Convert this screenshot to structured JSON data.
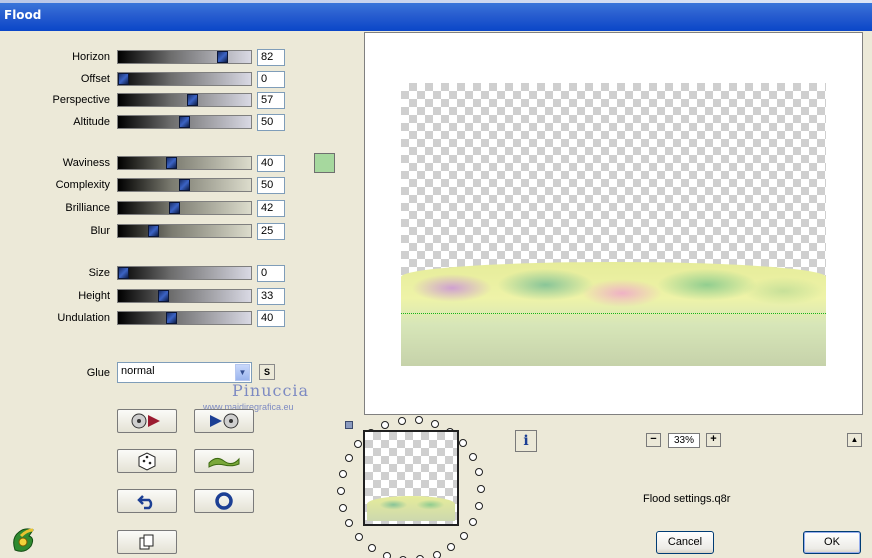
{
  "window": {
    "title": "Flood"
  },
  "parameters": [
    {
      "label": "Horizon",
      "value": "82",
      "fraction": 0.82
    },
    {
      "label": "Offset",
      "value": "0",
      "fraction": 0.0
    },
    {
      "label": "Perspective",
      "value": "57",
      "fraction": 0.57
    },
    {
      "label": "Altitude",
      "value": "50",
      "fraction": 0.5
    },
    {
      "label": "Waviness",
      "value": "40",
      "fraction": 0.4
    },
    {
      "label": "Complexity",
      "value": "50",
      "fraction": 0.5
    },
    {
      "label": "Brilliance",
      "value": "42",
      "fraction": 0.42
    },
    {
      "label": "Blur",
      "value": "25",
      "fraction": 0.25
    },
    {
      "label": "Size",
      "value": "0",
      "fraction": 0.0
    },
    {
      "label": "Height",
      "value": "33",
      "fraction": 0.33
    },
    {
      "label": "Undulation",
      "value": "40",
      "fraction": 0.4
    }
  ],
  "flood_color": "#a6d89e",
  "glue": {
    "label": "Glue",
    "value": "normal",
    "lock_label": "S"
  },
  "watermark": {
    "name": "Pinuccia",
    "site": "www.maidiregrafica.eu"
  },
  "tool_buttons": [
    {
      "name": "play-reverse-button",
      "icon": "reel-play-icon"
    },
    {
      "name": "play-forward-button",
      "icon": "play-reel-icon"
    },
    {
      "name": "random-button",
      "icon": "dice-icon"
    },
    {
      "name": "wave-button",
      "icon": "wave-icon"
    },
    {
      "name": "reset-button",
      "icon": "undo-arrow-icon"
    },
    {
      "name": "options-button",
      "icon": "ring-icon"
    },
    {
      "name": "copy-button",
      "icon": "copy-page-icon"
    }
  ],
  "zoom": {
    "value": "33%",
    "minus": "−",
    "plus": "+"
  },
  "settings_file": "Flood settings.q8r",
  "buttons": {
    "cancel": "Cancel",
    "ok": "OK"
  },
  "colors": {
    "titlebar": "#0a46c8",
    "dialog_bg": "#ece9d8",
    "horizon_line": "#18b418"
  }
}
